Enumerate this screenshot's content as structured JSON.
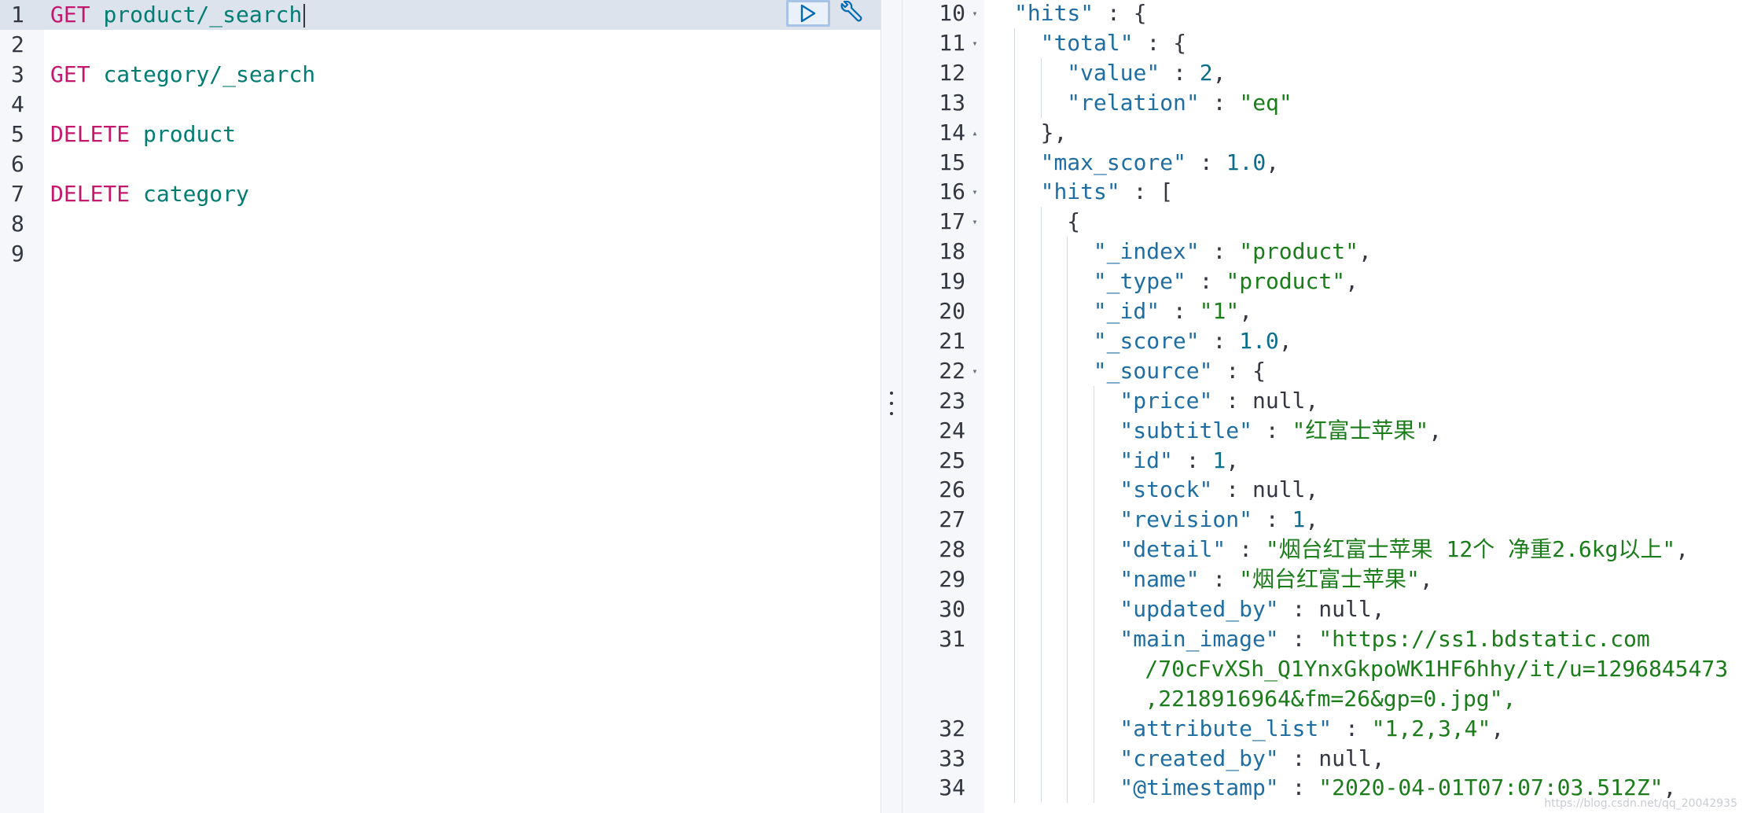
{
  "request_editor": {
    "lines": [
      {
        "num": "1",
        "method": "GET",
        "path": "product/_search"
      },
      {
        "num": "2",
        "method": "",
        "path": ""
      },
      {
        "num": "3",
        "method": "GET",
        "path": "category/_search"
      },
      {
        "num": "4",
        "method": "",
        "path": ""
      },
      {
        "num": "5",
        "method": "DELETE",
        "path": "product"
      },
      {
        "num": "6",
        "method": "",
        "path": ""
      },
      {
        "num": "7",
        "method": "DELETE",
        "path": "category"
      },
      {
        "num": "8",
        "method": "",
        "path": ""
      },
      {
        "num": "9",
        "method": "",
        "path": ""
      }
    ],
    "actions": {
      "run_icon": "play-icon",
      "settings_icon": "wrench-icon"
    }
  },
  "response_viewer": {
    "lines": [
      {
        "num": "10",
        "fold": "▾",
        "depth": 0,
        "key": "\"hits\"",
        "sep": " : ",
        "value": "{",
        "vtype": "punct"
      },
      {
        "num": "11",
        "fold": "▾",
        "depth": 1,
        "key": "\"total\"",
        "sep": " : ",
        "value": "{",
        "vtype": "punct"
      },
      {
        "num": "12",
        "fold": "",
        "depth": 2,
        "key": "\"value\"",
        "sep": " : ",
        "value": "2",
        "vtype": "num",
        "trail": ","
      },
      {
        "num": "13",
        "fold": "",
        "depth": 2,
        "key": "\"relation\"",
        "sep": " : ",
        "value": "\"eq\"",
        "vtype": "str"
      },
      {
        "num": "14",
        "fold": "▴",
        "depth": 1,
        "key": "",
        "sep": "",
        "value": "},",
        "vtype": "punct"
      },
      {
        "num": "15",
        "fold": "",
        "depth": 1,
        "key": "\"max_score\"",
        "sep": " : ",
        "value": "1.0",
        "vtype": "num",
        "trail": ","
      },
      {
        "num": "16",
        "fold": "▾",
        "depth": 1,
        "key": "\"hits\"",
        "sep": " : ",
        "value": "[",
        "vtype": "punct"
      },
      {
        "num": "17",
        "fold": "▾",
        "depth": 2,
        "key": "",
        "sep": "",
        "value": "{",
        "vtype": "punct"
      },
      {
        "num": "18",
        "fold": "",
        "depth": 3,
        "key": "\"_index\"",
        "sep": " : ",
        "value": "\"product\"",
        "vtype": "str",
        "trail": ","
      },
      {
        "num": "19",
        "fold": "",
        "depth": 3,
        "key": "\"_type\"",
        "sep": " : ",
        "value": "\"product\"",
        "vtype": "str",
        "trail": ","
      },
      {
        "num": "20",
        "fold": "",
        "depth": 3,
        "key": "\"_id\"",
        "sep": " : ",
        "value": "\"1\"",
        "vtype": "str",
        "trail": ","
      },
      {
        "num": "21",
        "fold": "",
        "depth": 3,
        "key": "\"_score\"",
        "sep": " : ",
        "value": "1.0",
        "vtype": "num",
        "trail": ","
      },
      {
        "num": "22",
        "fold": "▾",
        "depth": 3,
        "key": "\"_source\"",
        "sep": " : ",
        "value": "{",
        "vtype": "punct"
      },
      {
        "num": "23",
        "fold": "",
        "depth": 4,
        "key": "\"price\"",
        "sep": " : ",
        "value": "null",
        "vtype": "lit",
        "trail": ","
      },
      {
        "num": "24",
        "fold": "",
        "depth": 4,
        "key": "\"subtitle\"",
        "sep": " : ",
        "value": "\"红富士苹果\"",
        "vtype": "str",
        "trail": ","
      },
      {
        "num": "25",
        "fold": "",
        "depth": 4,
        "key": "\"id\"",
        "sep": " : ",
        "value": "1",
        "vtype": "num",
        "trail": ","
      },
      {
        "num": "26",
        "fold": "",
        "depth": 4,
        "key": "\"stock\"",
        "sep": " : ",
        "value": "null",
        "vtype": "lit",
        "trail": ","
      },
      {
        "num": "27",
        "fold": "",
        "depth": 4,
        "key": "\"revision\"",
        "sep": " : ",
        "value": "1",
        "vtype": "num",
        "trail": ","
      },
      {
        "num": "28",
        "fold": "",
        "depth": 4,
        "key": "\"detail\"",
        "sep": " : ",
        "value": "\"烟台红富士苹果 12个 净重2.6kg以上\"",
        "vtype": "str",
        "trail": ","
      },
      {
        "num": "29",
        "fold": "",
        "depth": 4,
        "key": "\"name\"",
        "sep": " : ",
        "value": "\"烟台红富士苹果\"",
        "vtype": "str",
        "trail": ","
      },
      {
        "num": "30",
        "fold": "",
        "depth": 4,
        "key": "\"updated_by\"",
        "sep": " : ",
        "value": "null",
        "vtype": "lit",
        "trail": ","
      },
      {
        "num": "31",
        "fold": "",
        "depth": 4,
        "key": "\"main_image\"",
        "sep": " : ",
        "value": "\"https://ss1.bdstatic.com",
        "vtype": "str",
        "continuation": [
          "/70cFvXSh_Q1YnxGkpoWK1HF6hhy/it/u=1296845473",
          ",2218916964&fm=26&gp=0.jpg\","
        ]
      },
      {
        "num": "32",
        "fold": "",
        "depth": 4,
        "key": "\"attribute_list\"",
        "sep": " : ",
        "value": "\"1,2,3,4\"",
        "vtype": "str",
        "trail": ","
      },
      {
        "num": "33",
        "fold": "",
        "depth": 4,
        "key": "\"created_by\"",
        "sep": " : ",
        "value": "null",
        "vtype": "lit",
        "trail": ","
      },
      {
        "num": "34",
        "fold": "",
        "depth": 4,
        "key": "\"@timestamp\"",
        "sep": " : ",
        "value": "\"2020-04-01T07:07:03.512Z\"",
        "vtype": "str",
        "trail": ","
      }
    ]
  },
  "watermark": "https://blog.csdn.net/qq_20042935"
}
